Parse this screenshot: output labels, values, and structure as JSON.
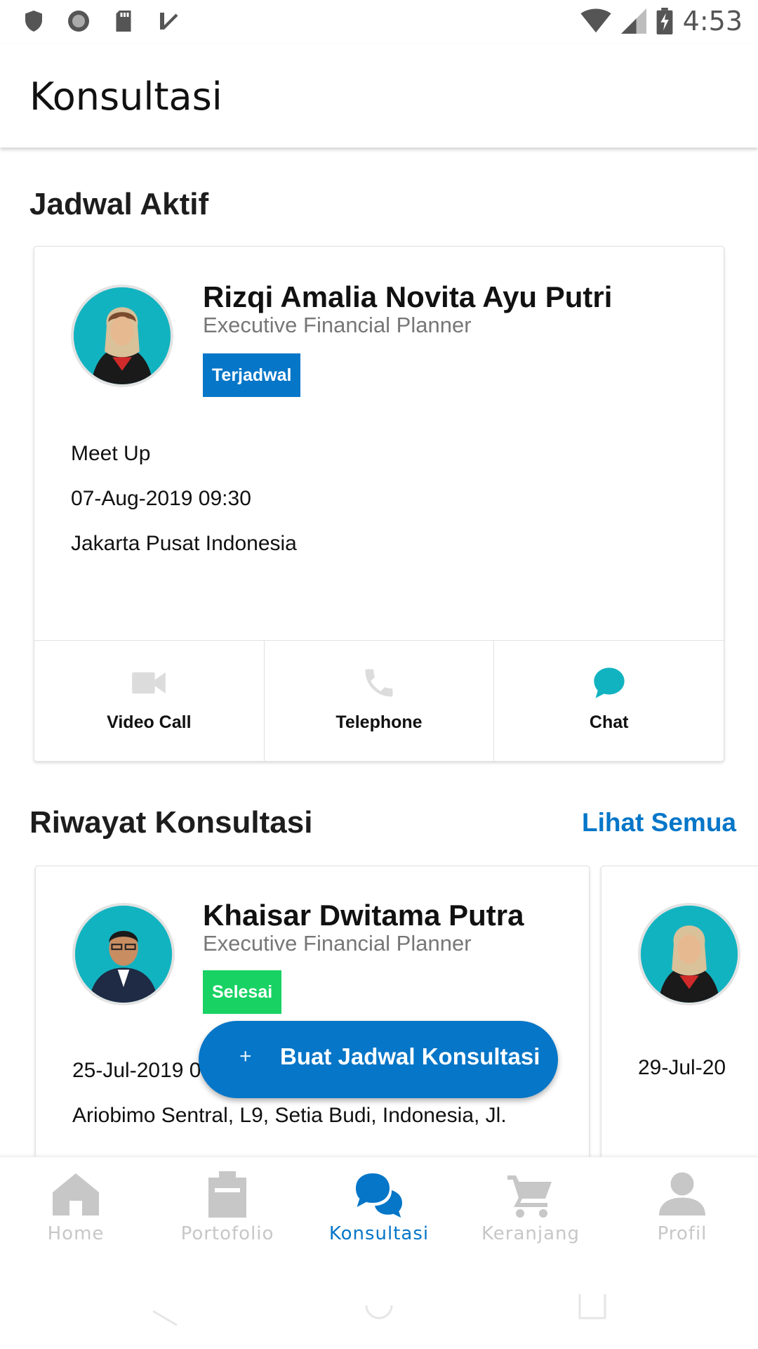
{
  "status_bar": {
    "time": "4:53",
    "left_icons": [
      "shield-icon",
      "circle-icon",
      "sd-card-icon",
      "task-check-icon"
    ],
    "right_icons": [
      "wifi-icon",
      "signal-icon",
      "battery-charging-icon"
    ]
  },
  "app_bar": {
    "title": "Konsultasi"
  },
  "active": {
    "title": "Jadwal Aktif",
    "card": {
      "name": "Rizqi Amalia Novita Ayu Putri",
      "role": "Executive Financial Planner",
      "badge": "Terjadwal",
      "type": "Meet Up",
      "datetime": "07-Aug-2019 09:30",
      "location": "Jakarta Pusat Indonesia",
      "actions": [
        {
          "label": "Video Call",
          "icon": "video-camera-icon"
        },
        {
          "label": "Telephone",
          "icon": "phone-icon"
        },
        {
          "label": "Chat",
          "icon": "chat-bubble-icon"
        }
      ]
    }
  },
  "history": {
    "title": "Riwayat Konsultasi",
    "see_all": "Lihat Semua",
    "cards": [
      {
        "name": "Khaisar Dwitama Putra",
        "role": "Executive Financial Planner",
        "badge": "Selesai",
        "datetime": "25-Jul-2019 0",
        "location": "Ariobimo Sentral, L9, Setia Budi, Indonesia, Jl."
      },
      {
        "datetime": "29-Jul-20"
      }
    ]
  },
  "fab": {
    "icon": "plus",
    "label": "Buat Jadwal Konsultasi"
  },
  "bottom_nav": {
    "items": [
      {
        "label": "Home",
        "icon": "home-icon"
      },
      {
        "label": "Portofolio",
        "icon": "clipboard-icon"
      },
      {
        "label": "Konsultasi",
        "icon": "chat-bubbles-icon",
        "active": true
      },
      {
        "label": "Keranjang",
        "icon": "cart-icon"
      },
      {
        "label": "Profil",
        "icon": "person-icon"
      }
    ]
  },
  "colors": {
    "primary": "#0576c8",
    "success": "#18d263",
    "avatar_bg": "#12b3c0",
    "inactive": "#c7c7c7"
  }
}
